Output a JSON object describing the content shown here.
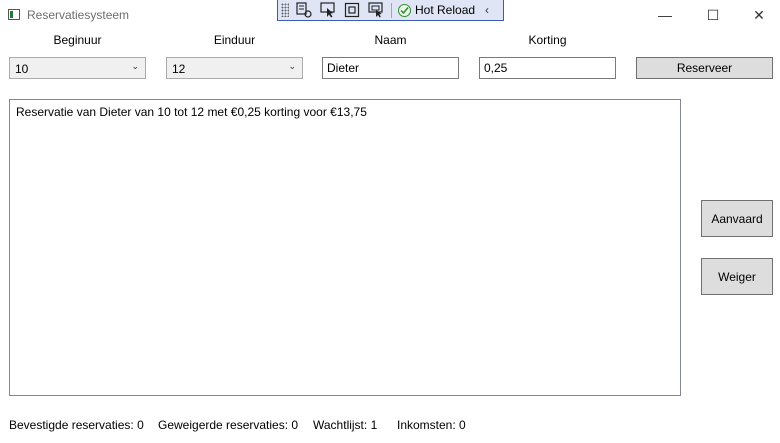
{
  "window": {
    "title": "Reservatiesysteem",
    "minimize_glyph": "—",
    "maximize_glyph": "☐",
    "close_glyph": "✕"
  },
  "dev_toolbar": {
    "hot_reload_label": "Hot Reload",
    "collapse_glyph": "‹",
    "icons": [
      "live-visual-tree-icon",
      "select-element-icon",
      "display-layout-adorners-icon",
      "track-focused-element-icon",
      "hot-reload-check-icon"
    ]
  },
  "form": {
    "beginuur": {
      "label": "Beginuur",
      "value": "10"
    },
    "einduur": {
      "label": "Einduur",
      "value": "12"
    },
    "naam": {
      "label": "Naam",
      "value": "Dieter"
    },
    "korting": {
      "label": "Korting",
      "value": "0,25"
    },
    "reserveer_label": "Reserveer"
  },
  "output": {
    "lines": [
      "Reservatie van Dieter van 10 tot 12 met €0,25 korting voor €13,75"
    ]
  },
  "actions": {
    "aanvaard_label": "Aanvaard",
    "weiger_label": "Weiger"
  },
  "status": {
    "bevestigd": "Bevestigde reservaties: 0",
    "geweigerd": "Geweigerde reservaties: 0",
    "wachtlijst": "Wachtlijst: 1",
    "inkomsten": "Inkomsten: 0"
  }
}
